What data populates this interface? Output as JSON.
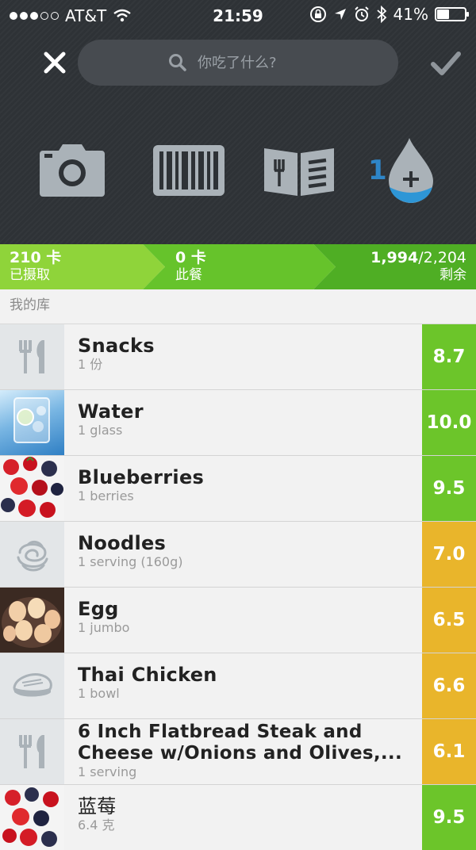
{
  "status_bar": {
    "carrier": "AT&T",
    "time": "21:59",
    "battery": "41%",
    "battery_level": 0.41
  },
  "search": {
    "placeholder": "你吃了什么?"
  },
  "tools": {
    "water_count": "1",
    "icons": [
      "camera-icon",
      "barcode-icon",
      "menu-book-icon",
      "water-drop-icon"
    ]
  },
  "summary": {
    "consumed": {
      "value": "210 卡",
      "label": "已摄取"
    },
    "meal": {
      "value": "0 卡",
      "label": "此餐"
    },
    "remaining": {
      "value": "1,994",
      "total": "/2,204",
      "label": "剩余"
    }
  },
  "library": {
    "title": "我的库"
  },
  "items": [
    {
      "name": "Snacks",
      "serving": "1 份",
      "score": "8.7",
      "thumb": "utensils-icon"
    },
    {
      "name": "Water",
      "serving": "1 glass",
      "score": "10.0",
      "thumb": "water-photo"
    },
    {
      "name": "Blueberries",
      "serving": "1 berries",
      "score": "9.5",
      "thumb": "berries-photo"
    },
    {
      "name": "Noodles",
      "serving": "1 serving (160g)",
      "score": "7.0",
      "thumb": "noodles-icon"
    },
    {
      "name": "Egg",
      "serving": "1 jumbo",
      "score": "6.5",
      "thumb": "eggs-photo"
    },
    {
      "name": "Thai Chicken",
      "serving": "1 bowl",
      "score": "6.6",
      "thumb": "meat-icon"
    },
    {
      "name": "6 Inch Flatbread Steak and Cheese w/Onions and Olives,...",
      "serving": "1 serving",
      "score": "6.1",
      "thumb": "utensils-icon"
    },
    {
      "name": "蓝莓",
      "serving": "6.4 克",
      "score": "9.5",
      "thumb": "berries-photo"
    }
  ],
  "colors": {
    "header_bg": "#2e3236",
    "green_light": "#8fd43a",
    "green": "#66c32b",
    "green_dark": "#4fae24",
    "score_green": "#6cc52a",
    "score_yellow": "#e9b52b",
    "icon_gray": "#aab2b8"
  }
}
